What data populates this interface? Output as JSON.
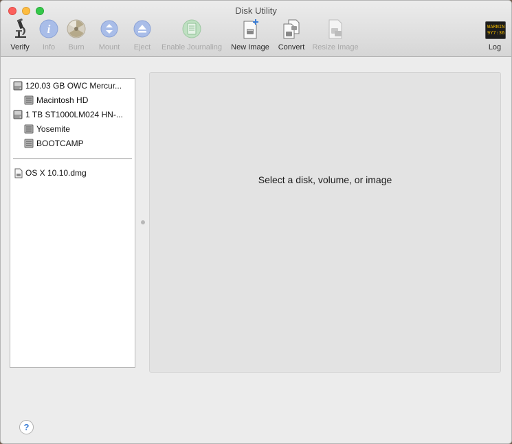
{
  "window": {
    "title": "Disk Utility"
  },
  "toolbar": {
    "verify": "Verify",
    "info": "Info",
    "burn": "Burn",
    "mount": "Mount",
    "eject": "Eject",
    "enable_journaling": "Enable Journaling",
    "new_image": "New Image",
    "convert": "Convert",
    "resize_image": "Resize Image",
    "log": "Log",
    "log_icon_text_1": "WARNIN",
    "log_icon_text_2": "9Y7:36"
  },
  "sidebar": {
    "items": [
      {
        "label": "120.03 GB OWC Mercur...",
        "type": "disk"
      },
      {
        "label": "Macintosh HD",
        "type": "volume"
      },
      {
        "label": "1 TB ST1000LM024 HN-...",
        "type": "disk"
      },
      {
        "label": "Yosemite",
        "type": "volume"
      },
      {
        "label": "BOOTCAMP",
        "type": "volume"
      },
      {
        "label": "OS X 10.10.dmg",
        "type": "image"
      }
    ]
  },
  "detail": {
    "message": "Select a disk, volume, or image"
  },
  "help": {
    "label": "?"
  },
  "colors": {
    "close": "#fc605c",
    "minimize": "#fdbc40",
    "maximize": "#34c84a",
    "help_accent": "#3b7ed6"
  }
}
